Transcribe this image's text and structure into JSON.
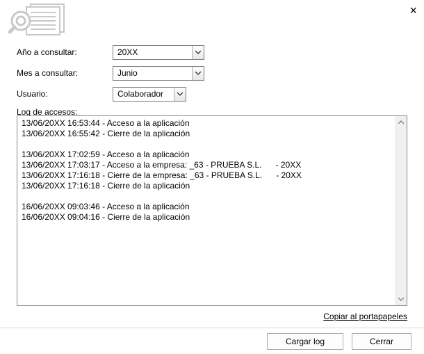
{
  "labels": {
    "year": "Año a consultar:",
    "month": "Mes a consultar:",
    "user": "Usuario:",
    "log_section": "Log de accesos:"
  },
  "fields": {
    "year": "20XX",
    "month": "Junio",
    "user": "Colaborador"
  },
  "log": {
    "lines": [
      "13/06/20XX 16:53:44 - Acceso a la aplicación",
      "13/06/20XX 16:55:42 - Cierre de la aplicación",
      "",
      "13/06/20XX 17:02:59 - Acceso a la aplicación",
      "13/06/20XX 17:03:17 - Acceso a la empresa: _63 - PRUEBA S.L.      - 20XX",
      "13/06/20XX 17:16:18 - Cierre de la empresa: _63 - PRUEBA S.L.      - 20XX",
      "13/06/20XX 17:16:18 - Cierre de la aplicación",
      "",
      "16/06/20XX 09:03:46 - Acceso a la aplicación",
      "16/06/20XX 09:04:16 - Cierre de la aplicación"
    ]
  },
  "actions": {
    "copy": "Copiar al portapapeles",
    "load": "Cargar log",
    "close_btn": "Cerrar"
  }
}
